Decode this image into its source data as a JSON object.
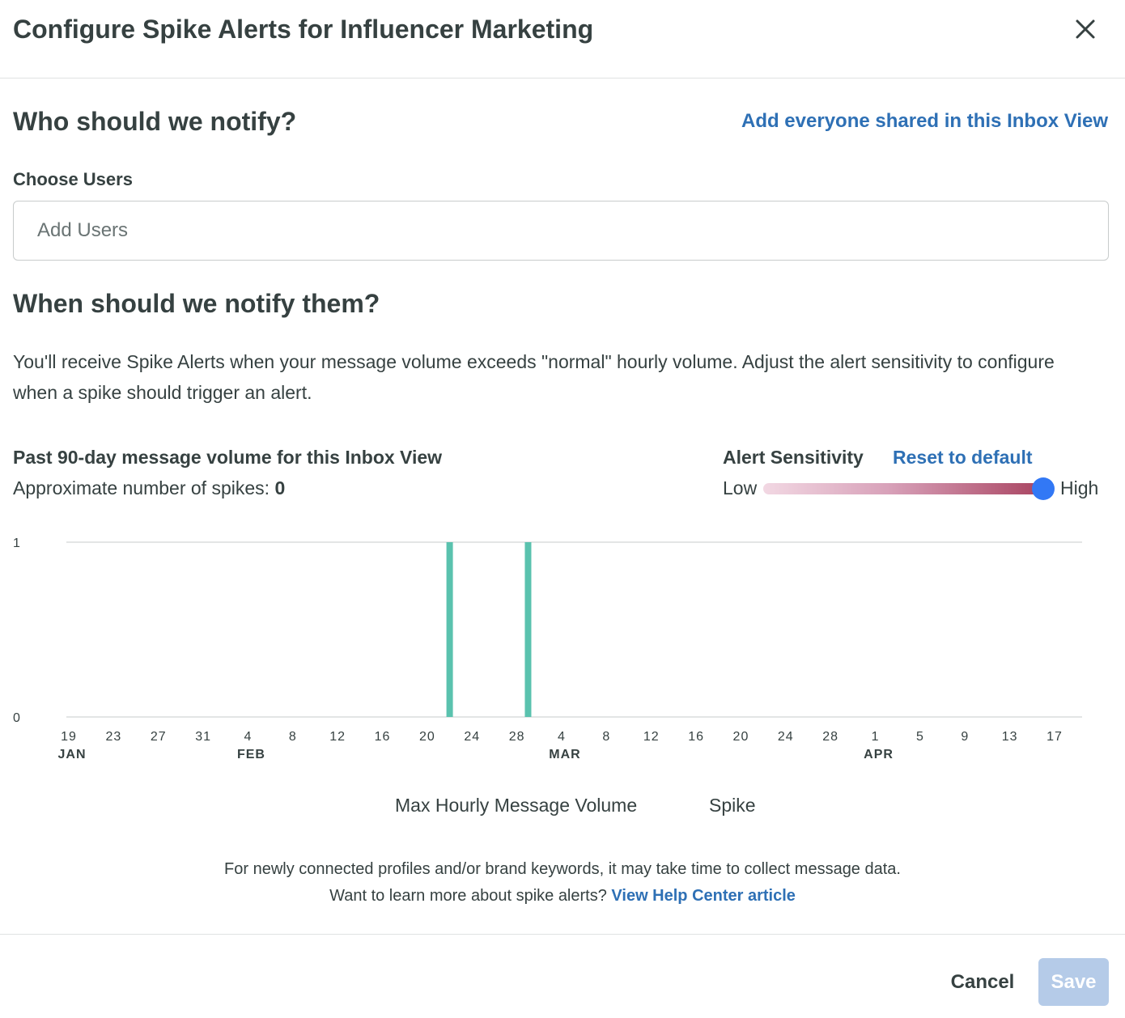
{
  "dialog": {
    "title": "Configure Spike Alerts for Influencer Marketing",
    "close_icon": "close-icon"
  },
  "notify": {
    "heading": "Who should we notify?",
    "add_everyone_link": "Add everyone shared in this Inbox View",
    "choose_users_label": "Choose Users",
    "users_placeholder": "Add Users"
  },
  "when": {
    "heading": "When should we notify them?",
    "description": "You'll receive Spike Alerts when your message volume exceeds \"normal\" hourly volume. Adjust the alert sensitivity to configure when a spike should trigger an alert."
  },
  "volume": {
    "title": "Past 90-day message volume for this Inbox View",
    "spikes_label": "Approximate number of spikes:",
    "spikes_count": "0"
  },
  "sensitivity": {
    "label": "Alert Sensitivity",
    "reset_link": "Reset to default",
    "low_label": "Low",
    "high_label": "High",
    "value": 1.0,
    "track_colors": [
      "#f2d8e3",
      "#a8425f"
    ],
    "thumb_color": "#3278f5"
  },
  "chart_data": {
    "type": "bar",
    "ylim": [
      0,
      1
    ],
    "y_ticks": [
      "0",
      "1"
    ],
    "x_ticks": [
      "19",
      "23",
      "27",
      "31",
      "4",
      "8",
      "12",
      "16",
      "20",
      "24",
      "28",
      "4",
      "8",
      "12",
      "16",
      "20",
      "24",
      "28",
      "1",
      "5",
      "9",
      "13",
      "17"
    ],
    "month_labels": [
      {
        "label": "JAN",
        "tick_index": 0
      },
      {
        "label": "FEB",
        "tick_index": 4
      },
      {
        "label": "MAR",
        "tick_index": 11
      },
      {
        "label": "APR",
        "tick_index": 18
      }
    ],
    "series": [
      {
        "name": "Max Hourly Message Volume",
        "color": "#5ac2ae",
        "points": [
          {
            "x": "Feb 22",
            "value": 1
          },
          {
            "x": "Mar 1",
            "value": 1
          }
        ]
      }
    ],
    "legend": [
      "Max Hourly Message Volume",
      "Spike"
    ],
    "grid": true
  },
  "footer_notes": {
    "line1": "For newly connected profiles and/or brand keywords, it may take time to collect message data.",
    "line2_prefix": "Want to learn more about spike alerts?",
    "help_link": "View Help Center article"
  },
  "actions": {
    "cancel_label": "Cancel",
    "save_label": "Save"
  },
  "colors": {
    "link": "#2e70b5",
    "text": "#364141",
    "save_disabled": "#b5cbe8"
  }
}
